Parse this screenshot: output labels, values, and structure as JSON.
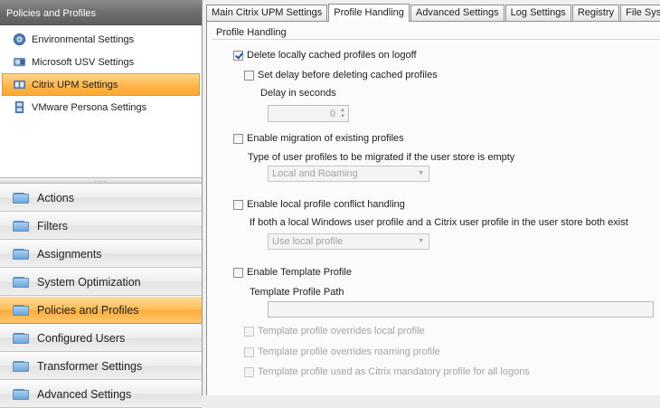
{
  "left_panel": {
    "header": "Policies and Profiles",
    "tree_items": [
      {
        "label": "Environmental Settings",
        "icon": "gear-icon",
        "selected": false
      },
      {
        "label": "Microsoft USV Settings",
        "icon": "usv-icon",
        "selected": false
      },
      {
        "label": "Citrix UPM Settings",
        "icon": "citrix-icon",
        "selected": true
      },
      {
        "label": "VMware Persona Settings",
        "icon": "vmware-icon",
        "selected": false
      }
    ],
    "splitter_grip": "....",
    "nav_buttons": [
      {
        "label": "Actions",
        "active": false
      },
      {
        "label": "Filters",
        "active": false
      },
      {
        "label": "Assignments",
        "active": false
      },
      {
        "label": "System Optimization",
        "active": false
      },
      {
        "label": "Policies and Profiles",
        "active": true
      },
      {
        "label": "Configured Users",
        "active": false
      },
      {
        "label": "Transformer Settings",
        "active": false
      },
      {
        "label": "Advanced Settings",
        "active": false
      }
    ]
  },
  "tabs": [
    {
      "label": "Main Citrix UPM Settings",
      "selected": false
    },
    {
      "label": "Profile Handling",
      "selected": true
    },
    {
      "label": "Advanced Settings",
      "selected": false
    },
    {
      "label": "Log Settings",
      "selected": false
    },
    {
      "label": "Registry",
      "selected": false
    },
    {
      "label": "File System",
      "selected": false
    }
  ],
  "profile_handling": {
    "group_title": "Profile Handling",
    "delete_cached": {
      "label": "Delete locally cached profiles on logoff",
      "checked": true
    },
    "set_delay": {
      "label": "Set delay before deleting cached profiles",
      "checked": false
    },
    "delay_label": "Delay in seconds",
    "delay_value": "0",
    "enable_migration": {
      "label": "Enable migration of existing profiles",
      "checked": false
    },
    "migration_type_label": "Type of user profiles to be migrated if the user store is empty",
    "migration_type_value": "Local and Roaming",
    "enable_conflict": {
      "label": "Enable local profile conflict handling",
      "checked": false
    },
    "conflict_label": "If both a local Windows user profile and a Citrix user profile in the user store both exist",
    "conflict_value": "Use local profile",
    "enable_template": {
      "label": "Enable Template Profile",
      "checked": false
    },
    "template_path_label": "Template Profile Path",
    "template_path_value": "",
    "override_local": {
      "label": "Template profile overrides local profile",
      "checked": false
    },
    "override_roaming": {
      "label": "Template profile overrides roaming profile",
      "checked": false
    },
    "mandatory": {
      "label": "Template profile used as Citrix mandatory profile for all logons",
      "checked": false
    }
  },
  "colors": {
    "accent_orange": "#ffb54a",
    "header_gray": "#6e6e6e",
    "folder_blue": "#6fa7d8"
  }
}
